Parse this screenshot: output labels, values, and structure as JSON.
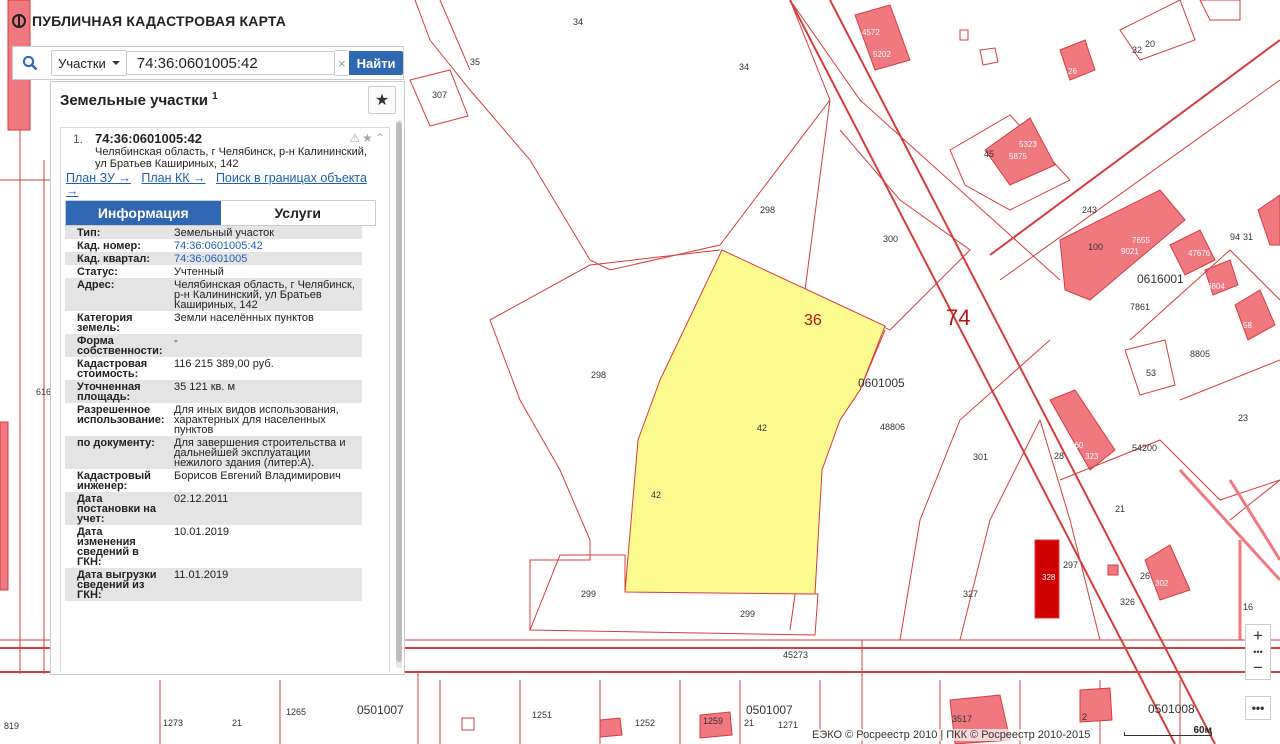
{
  "app": {
    "title": "ПУБЛИЧНАЯ КАДАСТРОВАЯ КАРТА"
  },
  "search": {
    "type_label": "Участки",
    "value": "74:36:0601005:42",
    "button_label": "Найти"
  },
  "panel": {
    "title": "Земельные участки",
    "count": "1",
    "item": {
      "num": "1.",
      "cad": "74:36:0601005:42",
      "address": "Челябинская область, г Челябинск, р-н Калининский, ул Братьев Кашириных, 142",
      "links": [
        "План ЗУ →",
        "План КК →",
        "Поиск в границах объекта →"
      ],
      "tabs": [
        "Информация",
        "Услуги"
      ],
      "attrs": [
        {
          "k": "Тип:",
          "v": "Земельный участок"
        },
        {
          "k": "Кад. номер:",
          "v": "74:36:0601005:42",
          "link": true
        },
        {
          "k": "Кад. квартал:",
          "v": "74:36:0601005",
          "link": true
        },
        {
          "k": "Статус:",
          "v": "Учтенный"
        },
        {
          "k": "Адрес:",
          "v": "Челябинская область, г Челябинск, р-н Калининский, ул Братьев Кашириных, 142"
        },
        {
          "k": "Категория земель:",
          "v": "Земли населённых пунктов"
        },
        {
          "k": "Форма собственности:",
          "v": "-"
        },
        {
          "k": "Кадастровая стоимость:",
          "v": "116 215 389,00 руб."
        },
        {
          "k": "Уточненная площадь:",
          "v": "35 121 кв. м"
        },
        {
          "k": "Разрешенное использование:",
          "v": "Для иных видов использования, характерных для населенных пунктов"
        },
        {
          "k": "по документу:",
          "v": "Для завершения строительства и дальнейшей эксплуатации нежилого здания (литер:А)."
        },
        {
          "k": "Кадастровый инженер:",
          "v": "Борисов Евгений Владимирович"
        },
        {
          "k": "Дата постановки на учет:",
          "v": "02.12.2011"
        },
        {
          "k": "Дата изменения сведений в ГКН:",
          "v": "10.01.2019"
        },
        {
          "k": "Дата выгрузки сведений из ГКН:",
          "v": "11.01.2019"
        }
      ]
    }
  },
  "map": {
    "highlight_color": "#fdfb8f",
    "border_color": "#d63c3c",
    "labels": [
      "34",
      "35",
      "34",
      "307",
      "298",
      "298",
      "300",
      "36",
      "74",
      "42",
      "42",
      "0601005",
      "48806",
      "301",
      "299",
      "299",
      "327",
      "297",
      "326",
      "45273",
      "1273",
      "21",
      "1265",
      "0501007",
      "1251",
      "1252",
      "1259",
      "21",
      "0501007",
      "1271",
      "3517",
      "2",
      "0501008",
      "819",
      "616",
      "32",
      "20",
      "26",
      "45",
      "5323",
      "5875",
      "243",
      "100",
      "7655",
      "9021",
      "47676",
      "94",
      "31",
      "8804",
      "0616001",
      "7861",
      "58",
      "8805",
      "53",
      "23",
      "54200",
      "28",
      "160",
      "323",
      "21",
      "26",
      "302",
      "16",
      "4572",
      "5202",
      "328"
    ]
  },
  "controls": {
    "zoom_in": "+",
    "zoom_out": "−",
    "dots": "•••"
  },
  "footer": {
    "attribution": "ЕЭКО © Росреестр 2010 | ПКК © Росреестр 2010-2015",
    "scale": "60м"
  }
}
